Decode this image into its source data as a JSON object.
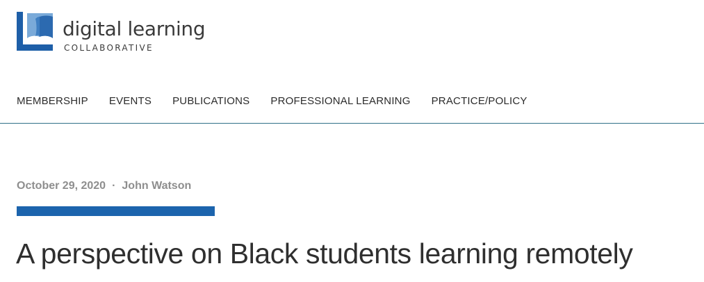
{
  "logo": {
    "name": "digital learning",
    "subtitle": "COLLABORATIVE",
    "colors": {
      "mark_dark": "#1e5fa8",
      "mark_light": "#7aaad9",
      "mark_mid": "#3f7fc2"
    }
  },
  "nav": {
    "items": [
      {
        "label": "MEMBERSHIP"
      },
      {
        "label": "EVENTS"
      },
      {
        "label": "PUBLICATIONS"
      },
      {
        "label": "PROFESSIONAL LEARNING"
      },
      {
        "label": "PRACTICE/POLICY"
      }
    ]
  },
  "article": {
    "date": "October 29, 2020",
    "separator": "·",
    "author": "John Watson",
    "title": "A perspective on Black students learning remotely"
  },
  "colors": {
    "accent": "#1c64ad",
    "divider": "#2f6f87",
    "meta_text": "#8e8e8e",
    "title_text": "#2f2f2f"
  }
}
